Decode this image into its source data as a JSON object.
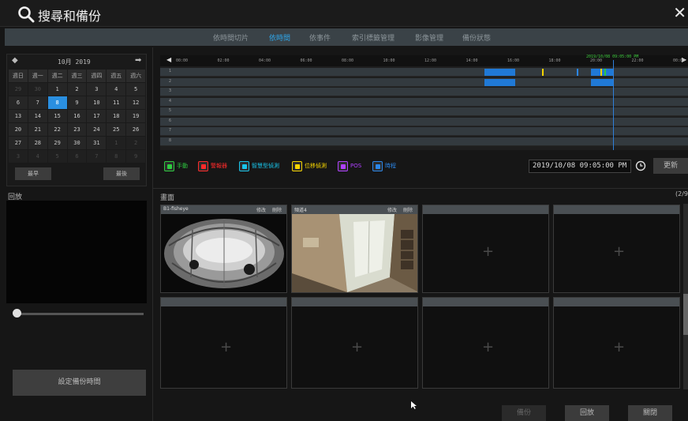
{
  "window": {
    "title": "搜尋和備份",
    "close_glyph": "✕"
  },
  "tabs": [
    {
      "label": "依時間切片",
      "active": false
    },
    {
      "label": "依時間",
      "active": true
    },
    {
      "label": "依事件",
      "active": false
    },
    {
      "label": "索引標籤管理",
      "active": false
    },
    {
      "label": "影像管理",
      "active": false
    },
    {
      "label": "備份狀態",
      "active": false
    }
  ],
  "calendar": {
    "prev_glyph": "◆",
    "next_glyph": "➡",
    "month_label": "10月   2019",
    "weekday_headers": [
      "週日",
      "週一",
      "週二",
      "週三",
      "週四",
      "週五",
      "週六"
    ],
    "weeks": [
      [
        "29",
        "30",
        "1",
        "2",
        "3",
        "4",
        "5"
      ],
      [
        "6",
        "7",
        "8",
        "9",
        "10",
        "11",
        "12"
      ],
      [
        "13",
        "14",
        "15",
        "16",
        "17",
        "18",
        "19"
      ],
      [
        "20",
        "21",
        "22",
        "23",
        "24",
        "25",
        "26"
      ],
      [
        "27",
        "28",
        "29",
        "30",
        "31",
        "1",
        "2"
      ],
      [
        "3",
        "4",
        "5",
        "6",
        "7",
        "8",
        "9"
      ]
    ],
    "selected_day": "8",
    "earliest_label": "最早",
    "latest_label": "最後"
  },
  "playback": {
    "label": "回放",
    "set_backup_time_label": "設定備份時間"
  },
  "timeline": {
    "ticks": [
      "00:00",
      "02:00",
      "04:00",
      "06:00",
      "08:00",
      "10:00",
      "12:00",
      "14:00",
      "16:00",
      "18:00",
      "20:00",
      "22:00",
      "00:00"
    ],
    "current_timestamp": "2019/10/08 09:05:00 PM",
    "rows": [
      "1",
      "2",
      "3",
      "4",
      "5",
      "6",
      "7",
      "8"
    ]
  },
  "legend": [
    {
      "label": "手動",
      "color": "#2ecc40",
      "icon": "hand-icon"
    },
    {
      "label": "警報器",
      "color": "#ff2a2a",
      "icon": "alarm-icon"
    },
    {
      "label": "智慧型偵測",
      "color": "#19c3e8",
      "icon": "smart-detect-icon"
    },
    {
      "label": "位移偵測",
      "color": "#f5d400",
      "icon": "motion-icon"
    },
    {
      "label": "POS",
      "color": "#b040ff",
      "icon": "pos-icon"
    },
    {
      "label": "時程",
      "color": "#2b86e8",
      "icon": "schedule-icon"
    }
  ],
  "search": {
    "datetime_value": "2019/10/08 09:05:00 PM",
    "refresh_label": "更新"
  },
  "screen": {
    "label": "畫面",
    "page_indicator": "(2/9",
    "thumbnails": [
      {
        "name": "B1-fisheye",
        "edit": "修改",
        "delete": "刪除"
      },
      {
        "name": "頻道4",
        "edit": "修改",
        "delete": "刪除"
      }
    ]
  },
  "bottom": {
    "backup_label": "備份",
    "playback_label": "回放",
    "close_label": "關閉"
  }
}
